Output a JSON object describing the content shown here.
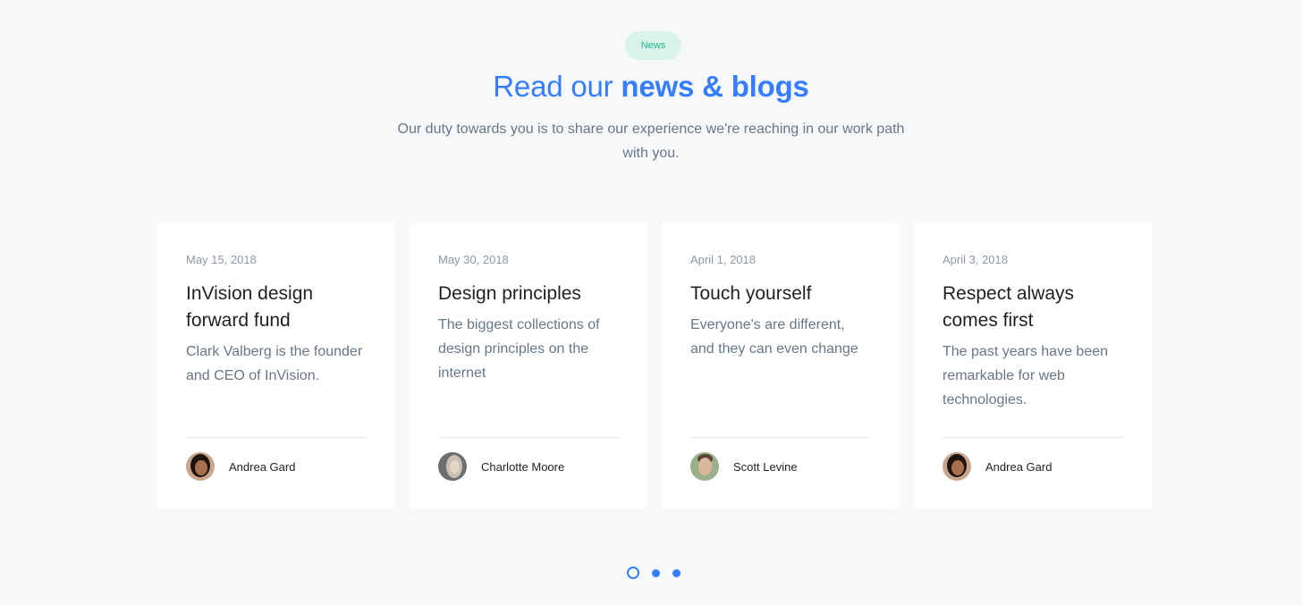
{
  "section": {
    "badge": "News",
    "title_part1": "Read our ",
    "title_part2": "news & blogs",
    "subtitle": "Our duty towards you is to share our experience we're reaching in our work path with you."
  },
  "posts": [
    {
      "date": "May 15, 2018",
      "title": "InVision design forward fund",
      "excerpt": "Clark Valberg is the founder and CEO of InVision.",
      "author": "Andrea Gard"
    },
    {
      "date": "May 30, 2018",
      "title": "Design principles",
      "excerpt": "The biggest collections of design principles on the internet",
      "author": "Charlotte Moore"
    },
    {
      "date": "April 1, 2018",
      "title": "Touch yourself",
      "excerpt": "Everyone's are different, and they can even change",
      "author": "Scott Levine"
    },
    {
      "date": "April 3, 2018",
      "title": "Respect always comes first",
      "excerpt": "The past years have been remarkable for web technologies.",
      "author": "Andrea Gard"
    }
  ],
  "pagination": {
    "pages": 3,
    "active": 1
  },
  "colors": {
    "accent": "#377dff",
    "badge_bg": "#d9f3ec",
    "badge_text": "#21b889",
    "background": "#f6f8fa"
  }
}
